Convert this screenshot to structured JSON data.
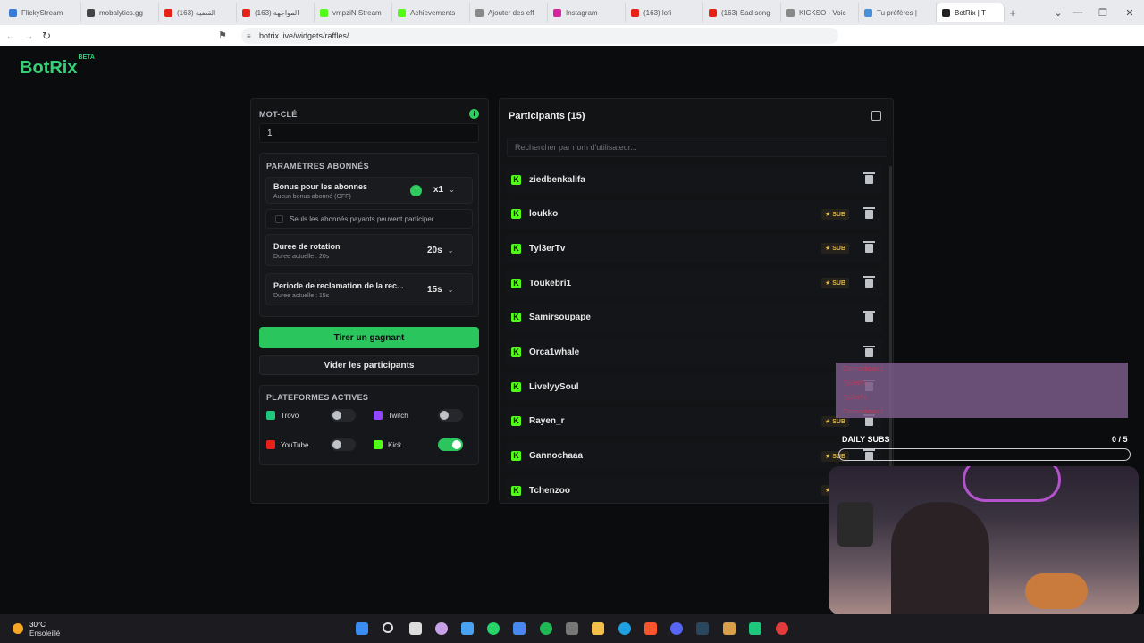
{
  "browser": {
    "tabs": [
      {
        "label": "FlickyStream",
        "color": "#3a7bd5"
      },
      {
        "label": "mobalytics.gg",
        "color": "#444"
      },
      {
        "label": "(163) القضية",
        "color": "#e62117"
      },
      {
        "label": "(163) المواجهة",
        "color": "#e62117"
      },
      {
        "label": "vmpziN Stream",
        "color": "#53fc18"
      },
      {
        "label": "Achievements",
        "color": "#53fc18"
      },
      {
        "label": "Ajouter des eff",
        "color": "#888"
      },
      {
        "label": "Instagram",
        "color": "#d6249f"
      },
      {
        "label": "(163) lofi",
        "color": "#e62117"
      },
      {
        "label": "(163) Sad song",
        "color": "#e62117"
      },
      {
        "label": "KICKSO - Voic",
        "color": "#888"
      },
      {
        "label": "Tu préfères |",
        "color": "#4a90d9"
      },
      {
        "label": "BotRix | T",
        "color": "#222"
      }
    ],
    "url": "botrix.live/widgets/raffles/"
  },
  "app": {
    "logo": "BotRix",
    "logo_badge": "BETA"
  },
  "settings": {
    "keyword_label": "MOT-CLÉ",
    "keyword_value": "1",
    "sub_params_title": "PARAMÈTRES ABONNÉS",
    "bonus_title": "Bonus pour les abonnes",
    "bonus_sub": "Aucun bonus abonné (OFF)",
    "bonus_value": "x1",
    "only_paid_label": "Seuls les abonnés payants peuvent participer",
    "rotation_title": "Duree de rotation",
    "rotation_sub": "Duree actuelle : 20s",
    "rotation_value": "20s",
    "claim_title": "Periode de reclamation de la rec...",
    "claim_sub": "Duree actuelle : 15s",
    "claim_value": "15s",
    "draw_button": "Tirer un gagnant",
    "clear_button": "Vider les participants",
    "platforms_title": "PLATEFORMES ACTIVES",
    "platforms": [
      {
        "name": "Trovo",
        "enabled": false,
        "color": "#1fc77c"
      },
      {
        "name": "Twitch",
        "enabled": false,
        "color": "#9146ff"
      },
      {
        "name": "YouTube",
        "enabled": false,
        "color": "#e62117"
      },
      {
        "name": "Kick",
        "enabled": true,
        "color": "#53fc18"
      }
    ]
  },
  "participants": {
    "title": "Participants (15)",
    "search_placeholder": "Rechercher par nom d'utilisateur...",
    "sub_label": "SUB",
    "list": [
      {
        "name": "ziedbenkalifa",
        "sub": false
      },
      {
        "name": "loukko",
        "sub": true
      },
      {
        "name": "Tyl3erTv",
        "sub": true
      },
      {
        "name": "Toukebri1",
        "sub": true
      },
      {
        "name": "Samirsoupape",
        "sub": false
      },
      {
        "name": "Orca1whale",
        "sub": false
      },
      {
        "name": "LivelyySoul",
        "sub": false
      },
      {
        "name": "Rayen_r",
        "sub": true
      },
      {
        "name": "Gannochaaa",
        "sub": true
      },
      {
        "name": "Tchenzoo",
        "sub": true
      }
    ]
  },
  "overlay": {
    "chat_lines": [
      "Gannochaaa 1",
      "Tyl3erTv",
      "Tyl3erTv",
      "Gannochaaa 1"
    ],
    "daily_label": "DAILY SUBS",
    "daily_count": "0 / 5",
    "daily_progress": 0
  },
  "taskbar": {
    "temp": "30°C",
    "weather": "Ensoleillé"
  },
  "colors": {
    "accent": "#2bc55e",
    "kick": "#53fc18",
    "sub_gold": "#e0b84a"
  }
}
